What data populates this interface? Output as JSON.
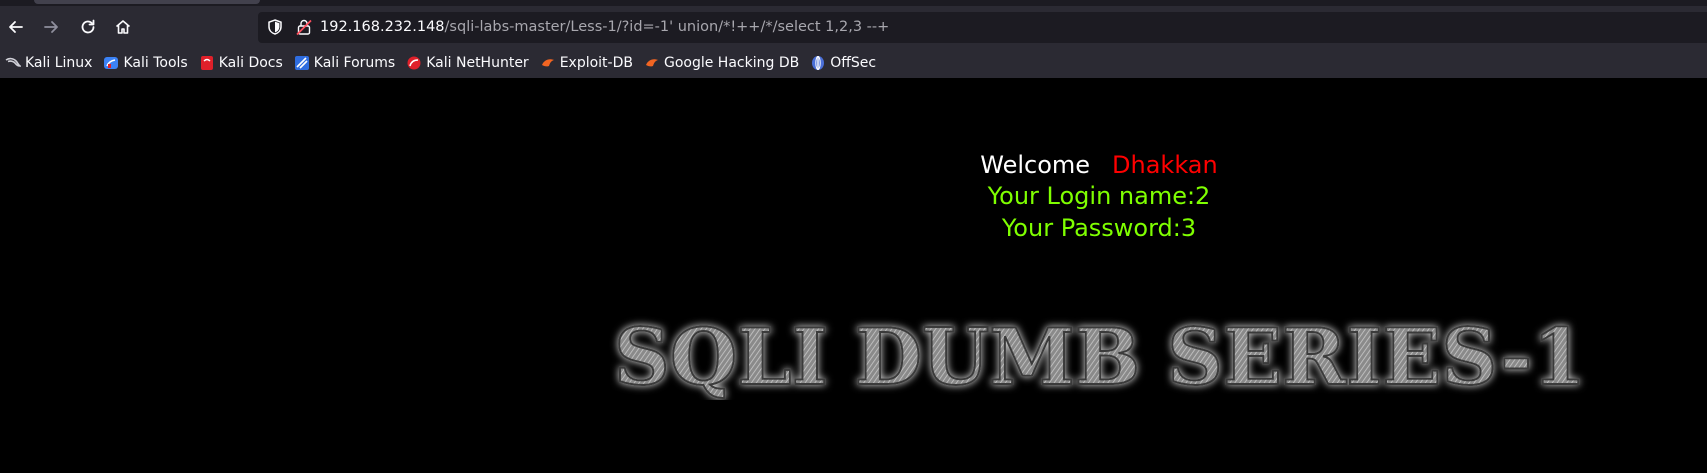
{
  "browser": {
    "url_host": "192.168.232.148",
    "url_path": "/sqli-labs-master/Less-1/?id=-1' union/*!++/*/select 1,2,3 --+"
  },
  "bookmarks": [
    {
      "label": "Kali Linux",
      "icon": "kali-dragon-icon",
      "color": "#2f6de0"
    },
    {
      "label": "Kali Tools",
      "icon": "kali-tools-icon",
      "color": "#3b82f6"
    },
    {
      "label": "Kali Docs",
      "icon": "kali-docs-icon",
      "color": "#e0202a"
    },
    {
      "label": "Kali Forums",
      "icon": "kali-forums-icon",
      "color": "#2f6de0"
    },
    {
      "label": "Kali NetHunter",
      "icon": "nethunter-icon",
      "color": "#e0202a"
    },
    {
      "label": "Exploit-DB",
      "icon": "exploit-db-icon",
      "color": "#f26522"
    },
    {
      "label": "Google Hacking DB",
      "icon": "ghdb-icon",
      "color": "#f26522"
    },
    {
      "label": "OffSec",
      "icon": "offsec-icon",
      "color": "#4a6fd8"
    }
  ],
  "page": {
    "welcome": "Welcome",
    "user": "Dhakkan",
    "login_line": "Your Login name:2",
    "password_line": "Your Password:3",
    "banner": "SQLI DUMB SERIES-1"
  },
  "colors": {
    "welcome": "#ffffff",
    "user": "#ff0000",
    "result": "#7fff00",
    "background": "#000000"
  }
}
